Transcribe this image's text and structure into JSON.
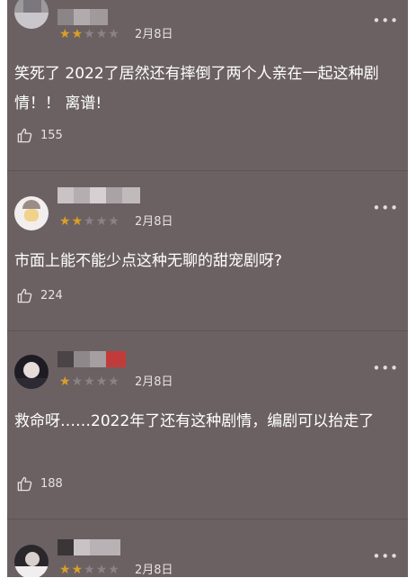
{
  "comments": [
    {
      "rating": 2,
      "stars_total": 5,
      "date": "2月8日",
      "more": "•••",
      "text": "笑死了 2022了居然还有摔倒了两个人亲在一起这种剧情！！ 离谱!",
      "likes": "155"
    },
    {
      "rating": 2,
      "stars_total": 5,
      "date": "2月8日",
      "more": "•••",
      "text": "市面上能不能少点这种无聊的甜宠剧呀?",
      "likes": "224"
    },
    {
      "rating": 1,
      "stars_total": 5,
      "date": "2月8日",
      "more": "•••",
      "text": "救命呀……2022年了还有这种剧情，编剧可以抬走了",
      "likes": "188"
    },
    {
      "rating": 2,
      "stars_total": 5,
      "date": "2月8日",
      "more": "•••"
    }
  ],
  "colors": {
    "background": "#6b6163",
    "star_on": "#d9a028",
    "star_off": "#8a8385",
    "text": "#ffffff"
  },
  "icons": {
    "like": "thumbs-up-icon",
    "more": "more-dots-icon",
    "star": "star-icon"
  }
}
